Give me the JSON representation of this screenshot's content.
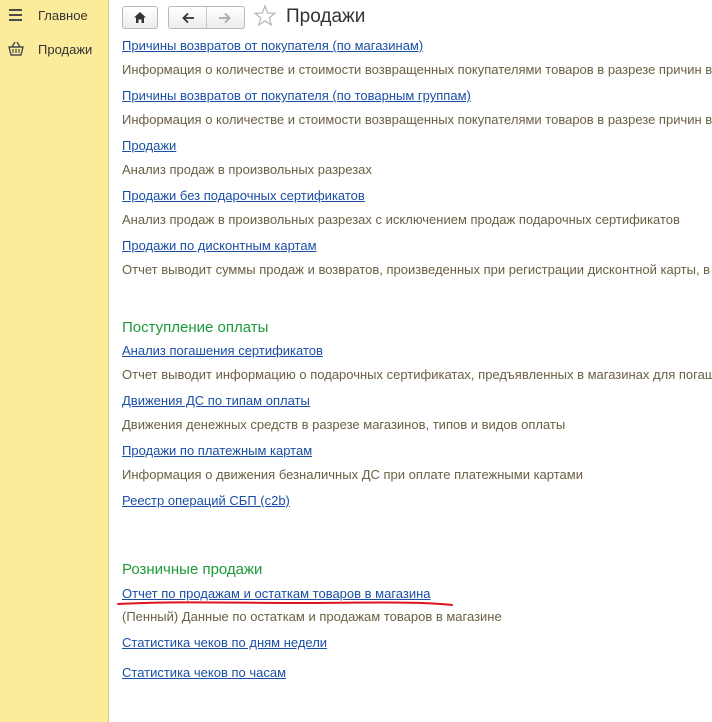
{
  "sidebar": {
    "items": [
      {
        "label": "Главное",
        "icon": "menu-lines-icon"
      },
      {
        "label": "Продажи",
        "icon": "basket-icon"
      }
    ]
  },
  "header": {
    "title": "Продажи",
    "icons": [
      "home-icon",
      "back-arrow-icon",
      "forward-arrow-icon",
      "favorite-star-icon"
    ]
  },
  "group1": {
    "items": [
      {
        "link": "Причины возвратов от покупателя (по магазинам)",
        "desc": "Информация о количестве и стоимости возвращенных покупателями товаров в разрезе причин во"
      },
      {
        "link": "Причины возвратов от покупателя (по товарным группам)",
        "desc": "Информация о количестве и стоимости возвращенных покупателями товаров в разрезе причин во"
      },
      {
        "link": "Продажи",
        "desc": "Анализ продаж в произвольных разрезах"
      },
      {
        "link": "Продажи без подарочных сертификатов",
        "desc": "Анализ продаж в произвольных разрезах с исключением продаж подарочных сертификатов"
      },
      {
        "link": "Продажи по дисконтным картам",
        "desc": "Отчет выводит суммы продаж и возвратов, произведенных при регистрации дисконтной карты, в р"
      }
    ]
  },
  "group2": {
    "title": "Поступление оплаты",
    "items": [
      {
        "link": "Анализ погашения сертификатов",
        "desc": "Отчет выводит информацию о подарочных сертификатах, предъявленных в магазинах для погаше"
      },
      {
        "link": "Движения ДС по типам оплаты",
        "desc": "Движения денежных средств в разрезе магазинов, типов и видов оплаты"
      },
      {
        "link": "Продажи по платежным картам",
        "desc": "Информация о движения безналичных ДС при оплате платежными картами"
      },
      {
        "link": "Реестр операций СБП (c2b)",
        "desc": ""
      }
    ]
  },
  "group3": {
    "title": "Розничные продажи",
    "items": [
      {
        "link": "Отчет по продажам и остаткам товаров в магазина",
        "desc": "(Пенный) Данные по остаткам и продажам товаров в магазине"
      },
      {
        "link": "Статистика чеков по дням недели",
        "desc": ""
      },
      {
        "link": "Статистика чеков по часам",
        "desc": ""
      }
    ]
  },
  "colors": {
    "sidebar_bg": "#fbec9c",
    "link": "#1b4fa6",
    "description": "#6a6044",
    "section_title": "#1d9a3b",
    "annotation_red": "#e0141b"
  }
}
